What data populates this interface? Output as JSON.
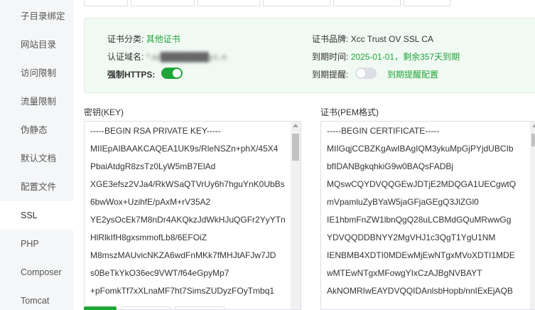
{
  "sidebar": {
    "items": [
      {
        "label": "子目录绑定",
        "active": false
      },
      {
        "label": "网站目录",
        "active": false
      },
      {
        "label": "访问限制",
        "active": false
      },
      {
        "label": "流量限制",
        "active": false
      },
      {
        "label": "伪静态",
        "active": false
      },
      {
        "label": "默认文档",
        "active": false
      },
      {
        "label": "配置文件",
        "active": false
      },
      {
        "label": "SSL",
        "active": true
      },
      {
        "label": "PHP",
        "active": false
      },
      {
        "label": "Composer",
        "active": false
      },
      {
        "label": "Tomcat",
        "active": false
      }
    ]
  },
  "cert_info": {
    "category_label": "证书分类:",
    "category_value": "其他证书",
    "domain_label": "认证域名:",
    "domain_value": "*.sz████████y.t..n",
    "https_label": "强制HTTPS:",
    "https_on": true,
    "brand_label": "证书品牌:",
    "brand_value": "Xcc Trust OV SSL CA",
    "expire_label": "到期时间:",
    "expire_value": "2025-01-01，剩余357天到期",
    "remind_label": "到期提醒:",
    "remind_on": false,
    "remind_link": "到期提醒配置"
  },
  "key_panel": {
    "label": "密钥(KEY)",
    "lines": [
      "-----BEGIN RSA PRIVATE KEY-----",
      "MIIEpAIBAAKCAQEA1UK9s/RleNSZn+phX/45X4",
      "PbaiAtdgR8zsTz0LyW5mB7ElAd",
      "XGE3efsz2VJa4/RkWSaQTVrUy6h7hguYnK0UbBs",
      "6bwWox+UzihfE/pAxM+rV35A2",
      "YE2ysOcEk7M8nDr4AKQkzJdWkHJuQGFr2YyYTn",
      "HlRlkIfH8gxsmmofLb8/6EFOiZ",
      "M8mszMAUvicNKZA6wdFnMKk7fMHJtAFJw7JD",
      "s0BeTkYkO36ec9VWT/f64eGpyMp7",
      "+pFomkTf7xXLnaMF7ht7SimsZUDyzFOyTmbq1"
    ]
  },
  "cert_panel": {
    "label": "证书(PEM格式)",
    "lines": [
      "-----BEGIN CERTIFICATE-----",
      "MIIGqjCCBZKgAwIBAgIQM3ykuMpGjPYjdUBCIb",
      "bfIDANBgkqhkiG9w0BAQsFADBj",
      "MQswCQYDVQQGEwJDTjE2MDQGA1UECgwtQ",
      "mVpamluZyBYaW5jaGFjaGEgQ3JlZGl0",
      "IE1hbmFnZW1lbnQgQ28uLCBMdGQuMRwwGg",
      "YDVQQDDBNYY2MgVHJ1c3QgT1YgU1NM",
      "IENBMB4XDTI0MDEwMjEwNTgxMVoXDTI1MDE",
      "wMTEwNTgxMFowgYIxCzAJBgNVBAYT",
      "AkNOMRIwEAYDVQQIDAnlsbHopb/nnIExEjAQB"
    ]
  }
}
